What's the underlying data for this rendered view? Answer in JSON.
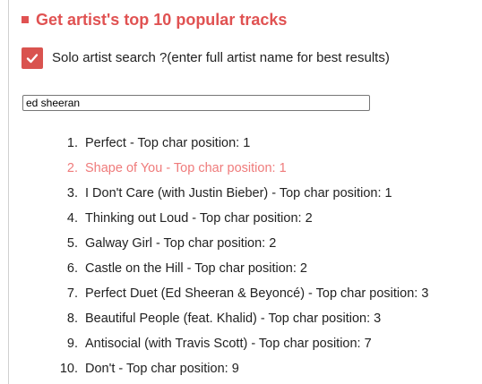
{
  "colors": {
    "accent": "#e05252",
    "highlight_text": "#ef7b7b",
    "checkbox_bg": "#d9534f"
  },
  "header": {
    "bullet_icon": "square-bullet",
    "title": "Get artist's top 10 popular tracks"
  },
  "solo": {
    "checked": true,
    "icon": "checkmark-icon",
    "label": "Solo artist search ?(enter full artist name for best results)"
  },
  "search": {
    "value": "ed sheeran"
  },
  "tracks": [
    {
      "num": "1.",
      "text": "Perfect - Top char position: 1",
      "highlighted": false
    },
    {
      "num": "2.",
      "text": "Shape of You - Top char position: 1",
      "highlighted": true
    },
    {
      "num": "3.",
      "text": "I Don't Care (with Justin Bieber) - Top char position: 1",
      "highlighted": false
    },
    {
      "num": "4.",
      "text": "Thinking out Loud - Top char position: 2",
      "highlighted": false
    },
    {
      "num": "5.",
      "text": "Galway Girl - Top char position: 2",
      "highlighted": false
    },
    {
      "num": "6.",
      "text": "Castle on the Hill - Top char position: 2",
      "highlighted": false
    },
    {
      "num": "7.",
      "text": "Perfect Duet (Ed Sheeran & Beyoncé) - Top char position: 3",
      "highlighted": false
    },
    {
      "num": "8.",
      "text": "Beautiful People (feat. Khalid) - Top char position: 3",
      "highlighted": false
    },
    {
      "num": "9.",
      "text": "Antisocial (with Travis Scott) - Top char position: 7",
      "highlighted": false
    },
    {
      "num": "10.",
      "text": "Don't - Top char position: 9",
      "highlighted": false
    }
  ]
}
